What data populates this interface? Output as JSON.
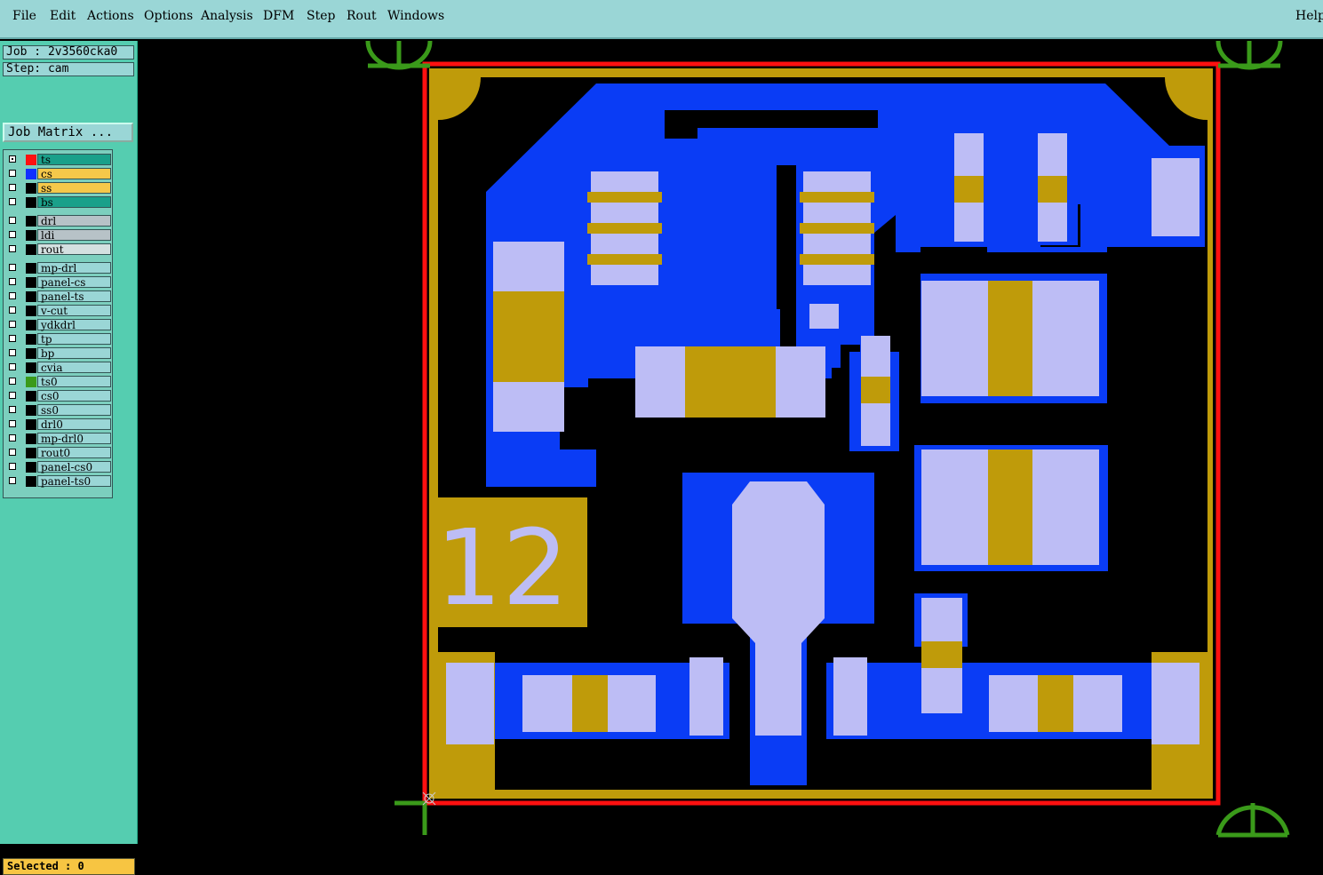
{
  "menu": {
    "file": "File",
    "edit": "Edit",
    "actions": "Actions",
    "options": "Options",
    "analysis": "Analysis",
    "dfm": "DFM",
    "step": "Step",
    "rout": "Rout",
    "windows": "Windows",
    "help": "Help"
  },
  "job_info": {
    "job": "Job : 2v3560cka0",
    "step": "Step: cam"
  },
  "job_matrix_button": "Job Matrix ...",
  "layers": [
    {
      "name": "ts",
      "swatch": "#ff1010",
      "bg": "#1aa08a",
      "checked": true
    },
    {
      "name": "cs",
      "swatch": "#1030ff",
      "bg": "#f5c84a",
      "checked": false
    },
    {
      "name": "ss",
      "swatch": "#000000",
      "bg": "#f5c84a",
      "checked": false
    },
    {
      "name": "bs",
      "swatch": "#000000",
      "bg": "#1aa08a",
      "checked": false
    },
    {
      "name": "drl",
      "swatch": "#000000",
      "bg": "#b7c2c7",
      "checked": false
    },
    {
      "name": "ldi",
      "swatch": "#000000",
      "bg": "#b7c2c7",
      "checked": false
    },
    {
      "name": "rout",
      "swatch": "#000000",
      "bg": "#d4e0e0",
      "checked": false
    },
    {
      "name": "mp-drl",
      "swatch": "#000000",
      "bg": "#9ad6d6",
      "checked": false
    },
    {
      "name": "panel-cs",
      "swatch": "#000000",
      "bg": "#9ad6d6",
      "checked": false
    },
    {
      "name": "panel-ts",
      "swatch": "#000000",
      "bg": "#9ad6d6",
      "checked": false
    },
    {
      "name": "v-cut",
      "swatch": "#000000",
      "bg": "#9ad6d6",
      "checked": false
    },
    {
      "name": "ydkdrl",
      "swatch": "#000000",
      "bg": "#9ad6d6",
      "checked": false
    },
    {
      "name": "tp",
      "swatch": "#000000",
      "bg": "#9ad6d6",
      "checked": false
    },
    {
      "name": "bp",
      "swatch": "#000000",
      "bg": "#9ad6d6",
      "checked": false
    },
    {
      "name": "cvia",
      "swatch": "#000000",
      "bg": "#9ad6d6",
      "checked": false
    },
    {
      "name": "ts0",
      "swatch": "#3a9a1a",
      "bg": "#9ad6d6",
      "checked": false
    },
    {
      "name": "cs0",
      "swatch": "#000000",
      "bg": "#9ad6d6",
      "checked": false
    },
    {
      "name": "ss0",
      "swatch": "#000000",
      "bg": "#9ad6d6",
      "checked": false
    },
    {
      "name": "drl0",
      "swatch": "#000000",
      "bg": "#9ad6d6",
      "checked": false
    },
    {
      "name": "mp-drl0",
      "swatch": "#000000",
      "bg": "#9ad6d6",
      "checked": false
    },
    {
      "name": "rout0",
      "swatch": "#000000",
      "bg": "#9ad6d6",
      "checked": false
    },
    {
      "name": "panel-cs0",
      "swatch": "#000000",
      "bg": "#9ad6d6",
      "checked": false
    },
    {
      "name": "panel-ts0",
      "swatch": "#000000",
      "bg": "#9ad6d6",
      "checked": false
    }
  ],
  "selected_status": "Selected : 0",
  "board": {
    "label": "12"
  },
  "colors": {
    "copper": "#bf9b0a",
    "trace": "#0a3cf5",
    "pad": "#bdbdf5",
    "outline": "#ff1010",
    "fiducial": "#3a9a1a",
    "background": "#000000"
  }
}
